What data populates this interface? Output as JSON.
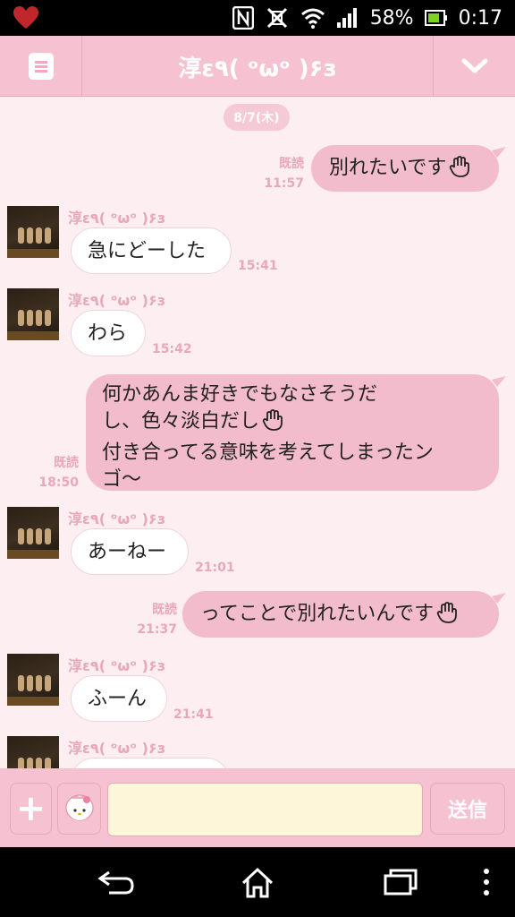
{
  "status": {
    "battery_percent": "58%",
    "time": "0:17"
  },
  "header": {
    "title": "淳ε٩( ᵒωᵒ )۶з"
  },
  "chat": {
    "date": "8/7(木)",
    "messages": [
      {
        "from": "me",
        "text": "別れたいです",
        "read_label": "既読",
        "time": "11:57",
        "hand": true
      },
      {
        "from": "them",
        "sender": "淳ε٩( ᵒωᵒ )۶з",
        "text": "急にどーした",
        "time": "15:41"
      },
      {
        "from": "them",
        "sender": "淳ε٩( ᵒωᵒ )۶з",
        "text": "わら",
        "time": "15:42"
      },
      {
        "from": "me",
        "lines": [
          "何かあんま好きでもなさそうだ",
          "し、色々淡白だし",
          "付き合ってる意味を考えてしまったン",
          "ゴ〜"
        ],
        "read_label": "既読",
        "time": "18:50",
        "hand": true
      },
      {
        "from": "them",
        "sender": "淳ε٩( ᵒωᵒ )۶з",
        "text": "あーねー",
        "time": "21:01"
      },
      {
        "from": "me",
        "text": "ってことで別れたいんです",
        "read_label": "既読",
        "time": "21:37",
        "hand": true
      },
      {
        "from": "them",
        "sender": "淳ε٩( ᵒωᵒ )۶з",
        "text": "ふーん",
        "time": "21:41"
      },
      {
        "from": "them",
        "sender": "淳ε٩( ᵒωᵒ )۶з",
        "text": "",
        "time": ""
      }
    ]
  },
  "input": {
    "plus_label": "+",
    "send_label": "送信",
    "placeholder": ""
  },
  "icons": {
    "status": [
      "heart-icon",
      "nfc-icon",
      "vibrate-icon",
      "wifi-icon",
      "signal-icon",
      "battery-icon"
    ],
    "header": [
      "menu-icon",
      "chevron-down-icon"
    ],
    "nav": [
      "back-icon",
      "home-icon",
      "recents-icon",
      "more-icon"
    ],
    "hand": "raised-hand-emoji",
    "sticker": "my-melody-icon"
  },
  "colors": {
    "accent": "#f6c1d1",
    "my_bubble": "#f3bccc",
    "chat_background": "#fdeef2",
    "meta_text": "#e8a8ba"
  }
}
